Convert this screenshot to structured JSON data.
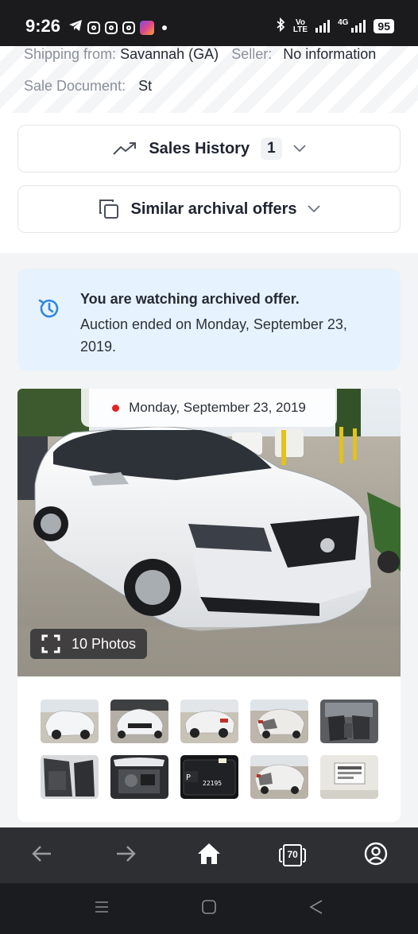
{
  "status_bar": {
    "time": "9:26",
    "network_label": "Vo LTE",
    "network_label_line1": "Vo",
    "network_label_line2": "LTE",
    "data_label": "4G",
    "battery": "95",
    "icons": [
      "telegram-icon",
      "instagram-icon",
      "instagram-icon",
      "instagram-icon",
      "app-icon",
      "notification-dot-icon",
      "bluetooth-icon",
      "signal-icon",
      "signal-icon"
    ]
  },
  "details": {
    "shipping_from_label": "Shipping from:",
    "shipping_from_value": "Savannah (GA)",
    "seller_label": "Seller:",
    "seller_value": "No information",
    "sale_document_label": "Sale Document:",
    "sale_document_value": "St"
  },
  "sales_history": {
    "label": "Sales History",
    "count": "1",
    "icon": "trending-up-icon"
  },
  "similar_offers": {
    "label": "Similar archival offers",
    "icon": "copy-icon"
  },
  "archive_notice": {
    "title": "You are watching archived offer.",
    "text": "Auction ended on Monday, September 23, 2019.",
    "icon": "history-icon",
    "icon_color": "#2e86de",
    "background": "#e6f2fd"
  },
  "gallery": {
    "date": "Monday, September 23, 2019",
    "photos_label": "10 Photos",
    "thumbnails": [
      "front-left",
      "front",
      "rear-left",
      "rear-damage",
      "interior-front",
      "interior-rear",
      "engine-bay",
      "odometer",
      "rear-right",
      "label-sticker"
    ],
    "odometer_reading": "22195",
    "odometer_gear": "P"
  },
  "bottom_nav": {
    "back_icon": "arrow-left-icon",
    "forward_icon": "arrow-right-icon",
    "home_icon": "home-icon",
    "tabs_count": "70",
    "profile_icon": "account-circle-icon"
  },
  "system_nav": {
    "icons": [
      "recent-apps-icon",
      "home-circle-icon",
      "back-triangle-icon"
    ]
  },
  "colors": {
    "status_bar": "#1b1b1d",
    "bottom_nav": "#2e2f33",
    "system_nav": "#1b1c1f",
    "accent_red": "#e02424"
  }
}
